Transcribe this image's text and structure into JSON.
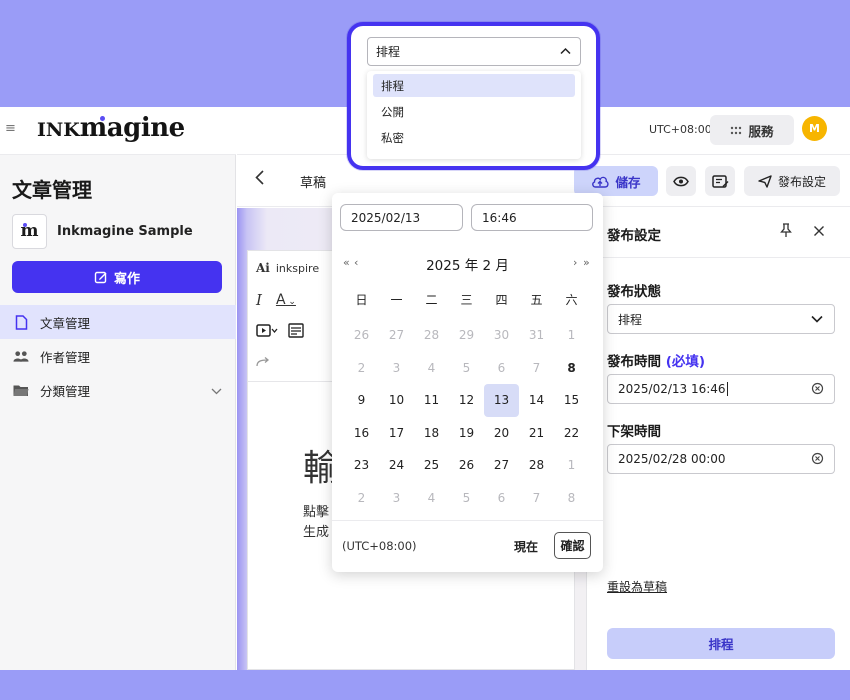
{
  "app": {
    "brand": "Inkmagine",
    "timezone": "UTC+08:00",
    "services_label": "服務",
    "avatar_initial": "M"
  },
  "sidebar": {
    "title": "文章管理",
    "org_name": "Inkmagine Sample",
    "write_label": "寫作",
    "items": [
      {
        "label": "文章管理",
        "icon": "document-icon",
        "active": true
      },
      {
        "label": "作者管理",
        "icon": "people-icon",
        "active": false
      },
      {
        "label": "分類管理",
        "icon": "folder-icon",
        "active": false
      }
    ]
  },
  "toolbar": {
    "status": "草稿",
    "save_label": "儲存",
    "publish_settings_label": "發布設定"
  },
  "editor": {
    "ai_label": "inkspire",
    "heading": "輸",
    "body_line1": "點擊",
    "body_line2": "生成"
  },
  "panel": {
    "title": "發布設定",
    "status_label": "發布狀態",
    "status_value": "排程",
    "publish_time_label": "發布時間",
    "publish_time_required": "(必填)",
    "publish_time_value": "2025/02/13 16:46",
    "unpublish_time_label": "下架時間",
    "unpublish_time_value": "2025/02/28 00:00",
    "reset_label": "重設為草稿",
    "submit_label": "排程"
  },
  "picker": {
    "date_value": "2025/02/13",
    "time_value": "16:46",
    "month_label": "2025 年  2 月",
    "weekdays": [
      "日",
      "一",
      "二",
      "三",
      "四",
      "五",
      "六"
    ],
    "weeks": [
      [
        "26",
        "27",
        "28",
        "29",
        "30",
        "31",
        "1"
      ],
      [
        "2",
        "3",
        "4",
        "5",
        "6",
        "7",
        "8"
      ],
      [
        "9",
        "10",
        "11",
        "12",
        "13",
        "14",
        "15"
      ],
      [
        "16",
        "17",
        "18",
        "19",
        "20",
        "21",
        "22"
      ],
      [
        "23",
        "24",
        "25",
        "26",
        "27",
        "28",
        "1"
      ],
      [
        "2",
        "3",
        "4",
        "5",
        "6",
        "7",
        "8"
      ]
    ],
    "timezone": "(UTC+08:00)",
    "now_label": "現在",
    "confirm_label": "確認"
  },
  "callout": {
    "selected": "排程",
    "options": [
      "排程",
      "公開",
      "私密"
    ]
  },
  "colors": {
    "accent": "#4533f0",
    "backdrop": "#9a9cf7",
    "selected_bg": "#dfe3fb"
  }
}
